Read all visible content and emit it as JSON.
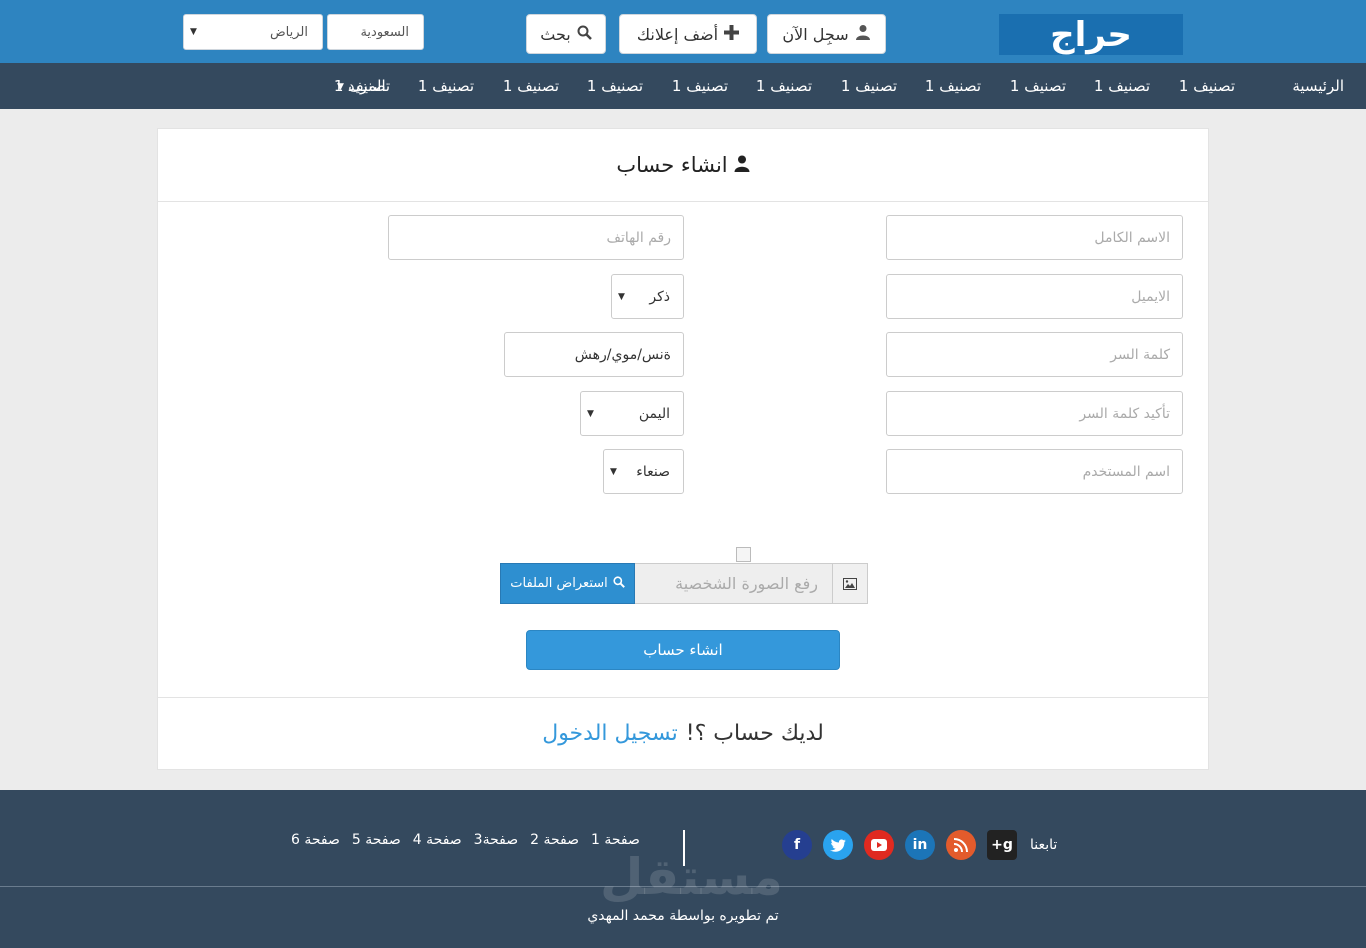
{
  "header": {
    "logo": "حراج",
    "register_label": "سجِل الآن",
    "add_ad_label": "أضف إعلانك",
    "search_label": "بحث",
    "country_select": "السعودية",
    "city_select": "الرياض"
  },
  "nav": {
    "home": "الرئيسية",
    "categories": [
      "تصنيف 1",
      "تصنيف 1",
      "تصنيف 1",
      "تصنيف 1",
      "تصنيف 1",
      "تصنيف 1",
      "تصنيف 1",
      "تصنيف 1",
      "تصنيف 1",
      "تصنيف 1",
      "تصنيف 1"
    ],
    "more": "المزيد"
  },
  "form": {
    "title": "انشاء حساب",
    "fields": {
      "full_name": "الاسم الكامل",
      "email": "الايميل",
      "password": "كلمة السر",
      "confirm_password": "تأكيد كلمة السر",
      "username": "اسم المستخدم",
      "phone": "رقم الهاتف",
      "gender": "ذكر",
      "birthdate": "ةنس/موي/رهش",
      "country": "اليمن",
      "city": "صنعاء"
    },
    "upload_placeholder": "رفع الصورة الشخصية",
    "browse_label": "استعراض الملفات",
    "submit_label": "انشاء حساب",
    "have_account": "لديك حساب ؟!",
    "login_link": "تسجيل الدخول"
  },
  "footer": {
    "follow_label": "تابعنا",
    "pages": [
      "صفحة 1",
      "صفحة 2",
      "صفحة3",
      "صفحة 4",
      "صفحة 5",
      "صفحة 6"
    ],
    "watermark": "مستقل",
    "credit": "تم تطويره بواسطة محمد المهدي"
  },
  "colors": {
    "header_blue": "#2e84c0",
    "nav_dark": "#34495e",
    "accent": "#3498db"
  }
}
